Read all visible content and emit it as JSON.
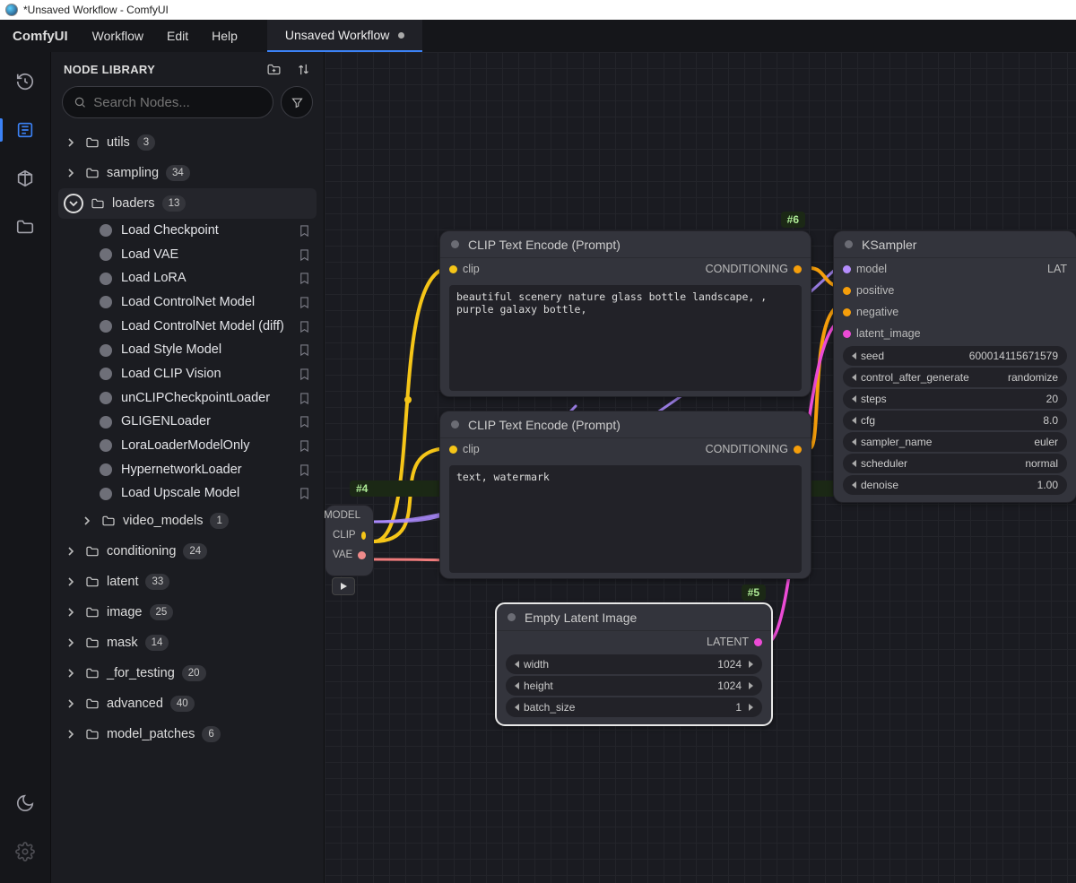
{
  "window": {
    "title": "*Unsaved Workflow - ComfyUI"
  },
  "menubar": {
    "brand": "ComfyUI",
    "items": [
      "Workflow",
      "Edit",
      "Help"
    ],
    "tab": "Unsaved Workflow"
  },
  "sidebar": {
    "title": "NODE LIBRARY",
    "search_placeholder": "Search Nodes...",
    "categories": [
      {
        "name": "utils",
        "count": "3",
        "level": 1,
        "state": "collapsed"
      },
      {
        "name": "sampling",
        "count": "34",
        "level": 1,
        "state": "collapsed"
      },
      {
        "name": "loaders",
        "count": "13",
        "level": 1,
        "state": "expanded",
        "children": [
          "Load Checkpoint",
          "Load VAE",
          "Load LoRA",
          "Load ControlNet Model",
          "Load ControlNet Model (diff)",
          "Load Style Model",
          "Load CLIP Vision",
          "unCLIPCheckpointLoader",
          "GLIGENLoader",
          "LoraLoaderModelOnly",
          "HypernetworkLoader",
          "Load Upscale Model"
        ],
        "after": [
          {
            "name": "video_models",
            "count": "1",
            "level": 2
          }
        ]
      },
      {
        "name": "conditioning",
        "count": "24",
        "level": 1,
        "state": "collapsed"
      },
      {
        "name": "latent",
        "count": "33",
        "level": 1,
        "state": "collapsed"
      },
      {
        "name": "image",
        "count": "25",
        "level": 1,
        "state": "collapsed"
      },
      {
        "name": "mask",
        "count": "14",
        "level": 1,
        "state": "collapsed"
      },
      {
        "name": "_for_testing",
        "count": "20",
        "level": 1,
        "state": "collapsed"
      },
      {
        "name": "advanced",
        "count": "40",
        "level": 1,
        "state": "collapsed"
      },
      {
        "name": "model_patches",
        "count": "6",
        "level": 1,
        "state": "collapsed"
      }
    ]
  },
  "canvas": {
    "stub_node": {
      "tag": "#4",
      "outputs": [
        "MODEL",
        "CLIP",
        "VAE"
      ]
    },
    "clip_pos": {
      "tag": "#6",
      "title": "CLIP Text Encode (Prompt)",
      "input": "clip",
      "output": "CONDITIONING",
      "text": "beautiful scenery nature glass bottle landscape, , purple galaxy bottle,"
    },
    "clip_neg": {
      "title": "CLIP Text Encode (Prompt)",
      "input": "clip",
      "output": "CONDITIONING",
      "text": "text, watermark"
    },
    "empty_latent": {
      "tag": "#5",
      "title": "Empty Latent Image",
      "output": "LATENT",
      "widgets": [
        {
          "name": "width",
          "value": "1024"
        },
        {
          "name": "height",
          "value": "1024"
        },
        {
          "name": "batch_size",
          "value": "1"
        }
      ]
    },
    "ksampler": {
      "title": "KSampler",
      "inputs": [
        "model",
        "positive",
        "negative",
        "latent_image"
      ],
      "output": "LAT",
      "widgets": [
        {
          "name": "seed",
          "value": "600014115671579"
        },
        {
          "name": "control_after_generate",
          "value": "randomize"
        },
        {
          "name": "steps",
          "value": "20"
        },
        {
          "name": "cfg",
          "value": "8.0"
        },
        {
          "name": "sampler_name",
          "value": "euler"
        },
        {
          "name": "scheduler",
          "value": "normal"
        },
        {
          "name": "denoise",
          "value": "1.00"
        }
      ]
    }
  }
}
